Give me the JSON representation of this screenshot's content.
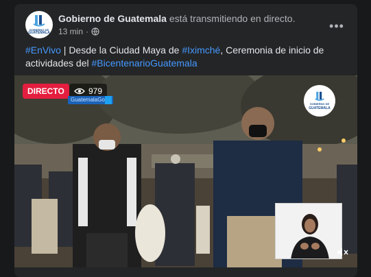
{
  "post": {
    "page_name": "Gobierno de Guatemala",
    "action_text": " está transmitiendo en directo.",
    "timestamp": "13 min",
    "privacy_icon": "globe-icon",
    "more_icon": "more-options-icon",
    "text_segments": [
      {
        "text": "#EnVivo",
        "hashtag": true
      },
      {
        "text": " | Desde la Ciudad Maya de ",
        "hashtag": false
      },
      {
        "text": "#Iximché",
        "hashtag": true
      },
      {
        "text": ", Ceremonia de inicio de actividades del  ",
        "hashtag": false
      },
      {
        "text": "#BicentenarioGuatemala",
        "hashtag": true
      }
    ]
  },
  "avatar": {
    "label": "GUATEMALA",
    "sublabel": "GOBIERNO DE"
  },
  "video": {
    "live_label": "DIRECTO",
    "viewer_count": "979",
    "viewer_icon": "eye-icon",
    "handle_text": "GuatemalaGob",
    "logo_label": "GUATEMALA",
    "logo_sublabel": "GOBIERNO DE",
    "volume_icon": "volume-muted-icon"
  },
  "colors": {
    "background": "#18191a",
    "card": "#242526",
    "text_primary": "#e4e6eb",
    "text_secondary": "#b0b3b8",
    "hashtag": "#4599ff",
    "live_red": "#e41e3f"
  }
}
